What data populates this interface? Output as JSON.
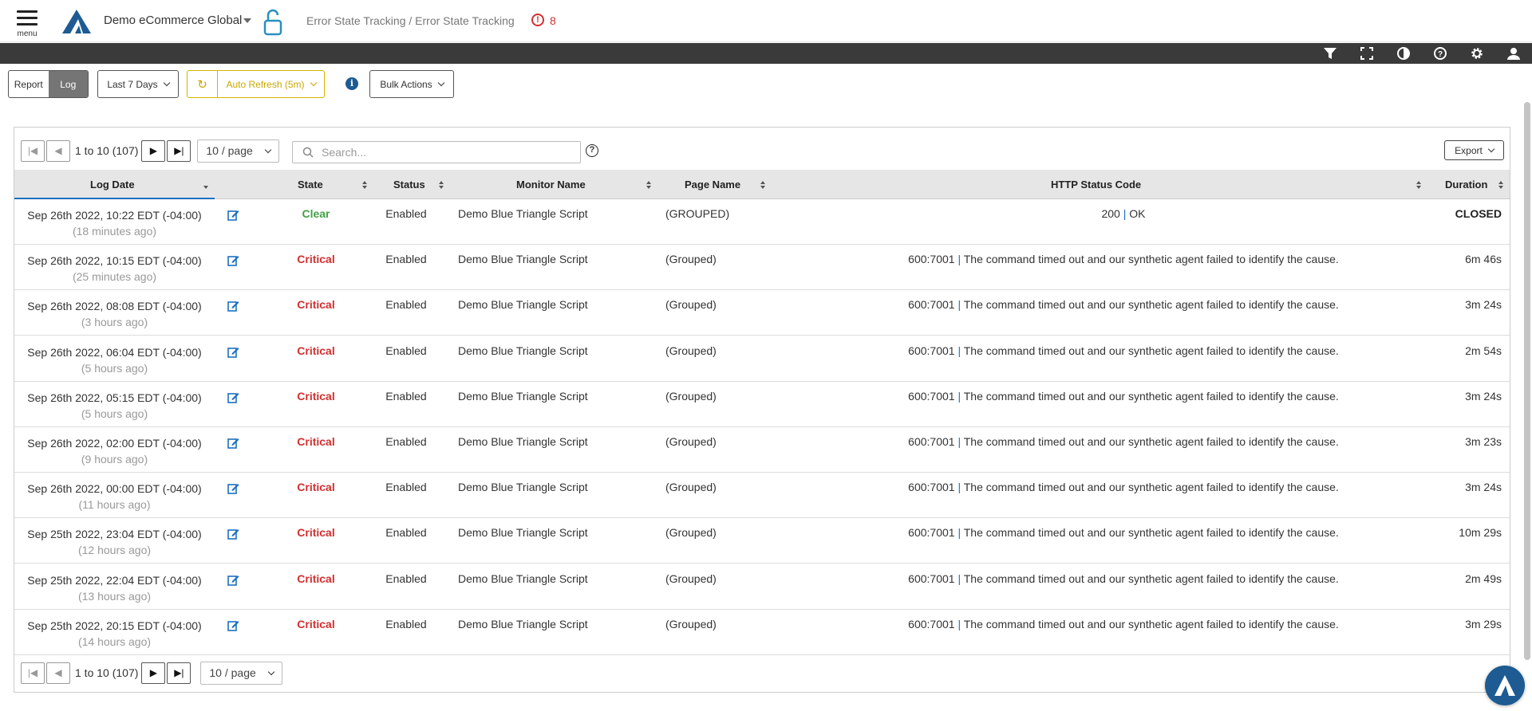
{
  "header": {
    "menu_label": "menu",
    "org_name": "Demo eCommerce Global",
    "breadcrumb": "Error State Tracking / Error State Tracking",
    "alert_count": "8"
  },
  "toolbar_icons": [
    "filter-icon",
    "fullscreen-icon",
    "contrast-icon",
    "help-icon",
    "gear-icon",
    "user-icon"
  ],
  "toolbar": {
    "report_label": "Report",
    "log_label": "Log",
    "date_range": "Last 7 Days",
    "auto_refresh": "Auto Refresh (5m)",
    "bulk_actions": "Bulk Actions"
  },
  "pager": {
    "range_text": "1 to 10 (107)",
    "page_size": "10 / page",
    "first": "|◀",
    "prev": "◀",
    "next": "▶",
    "last": "▶|"
  },
  "search": {
    "placeholder": "Search..."
  },
  "export_label": "Export",
  "columns": {
    "log_date": "Log Date",
    "state": "State",
    "status": "Status",
    "monitor_name": "Monitor Name",
    "page_name": "Page Name",
    "http_status": "HTTP Status Code",
    "duration": "Duration"
  },
  "colors": {
    "critical": "#d32f2f",
    "clear": "#43a047",
    "accent": "#1e6fbf"
  },
  "rows": [
    {
      "date": "Sep 26th 2022, 10:22 EDT (-04:00)",
      "ago": "(18 minutes ago)",
      "state": "Clear",
      "status": "Enabled",
      "monitor": "Demo Blue Triangle Script",
      "page": "(GROUPED)",
      "http_code": "200",
      "http_text": "OK",
      "duration": "CLOSED"
    },
    {
      "date": "Sep 26th 2022, 10:15 EDT (-04:00)",
      "ago": "(25 minutes ago)",
      "state": "Critical",
      "status": "Enabled",
      "monitor": "Demo Blue Triangle Script",
      "page": "(Grouped)",
      "http_code": "600:7001",
      "http_text": "The command timed out and our synthetic agent failed to identify the cause.",
      "duration": "6m 46s"
    },
    {
      "date": "Sep 26th 2022, 08:08 EDT (-04:00)",
      "ago": "(3 hours ago)",
      "state": "Critical",
      "status": "Enabled",
      "monitor": "Demo Blue Triangle Script",
      "page": "(Grouped)",
      "http_code": "600:7001",
      "http_text": "The command timed out and our synthetic agent failed to identify the cause.",
      "duration": "3m 24s"
    },
    {
      "date": "Sep 26th 2022, 06:04 EDT (-04:00)",
      "ago": "(5 hours ago)",
      "state": "Critical",
      "status": "Enabled",
      "monitor": "Demo Blue Triangle Script",
      "page": "(Grouped)",
      "http_code": "600:7001",
      "http_text": "The command timed out and our synthetic agent failed to identify the cause.",
      "duration": "2m 54s"
    },
    {
      "date": "Sep 26th 2022, 05:15 EDT (-04:00)",
      "ago": "(5 hours ago)",
      "state": "Critical",
      "status": "Enabled",
      "monitor": "Demo Blue Triangle Script",
      "page": "(Grouped)",
      "http_code": "600:7001",
      "http_text": "The command timed out and our synthetic agent failed to identify the cause.",
      "duration": "3m 24s"
    },
    {
      "date": "Sep 26th 2022, 02:00 EDT (-04:00)",
      "ago": "(9 hours ago)",
      "state": "Critical",
      "status": "Enabled",
      "monitor": "Demo Blue Triangle Script",
      "page": "(Grouped)",
      "http_code": "600:7001",
      "http_text": "The command timed out and our synthetic agent failed to identify the cause.",
      "duration": "3m 23s"
    },
    {
      "date": "Sep 26th 2022, 00:00 EDT (-04:00)",
      "ago": "(11 hours ago)",
      "state": "Critical",
      "status": "Enabled",
      "monitor": "Demo Blue Triangle Script",
      "page": "(Grouped)",
      "http_code": "600:7001",
      "http_text": "The command timed out and our synthetic agent failed to identify the cause.",
      "duration": "3m 24s"
    },
    {
      "date": "Sep 25th 2022, 23:04 EDT (-04:00)",
      "ago": "(12 hours ago)",
      "state": "Critical",
      "status": "Enabled",
      "monitor": "Demo Blue Triangle Script",
      "page": "(Grouped)",
      "http_code": "600:7001",
      "http_text": "The command timed out and our synthetic agent failed to identify the cause.",
      "duration": "10m 29s"
    },
    {
      "date": "Sep 25th 2022, 22:04 EDT (-04:00)",
      "ago": "(13 hours ago)",
      "state": "Critical",
      "status": "Enabled",
      "monitor": "Demo Blue Triangle Script",
      "page": "(Grouped)",
      "http_code": "600:7001",
      "http_text": "The command timed out and our synthetic agent failed to identify the cause.",
      "duration": "2m 49s"
    },
    {
      "date": "Sep 25th 2022, 20:15 EDT (-04:00)",
      "ago": "(14 hours ago)",
      "state": "Critical",
      "status": "Enabled",
      "monitor": "Demo Blue Triangle Script",
      "page": "(Grouped)",
      "http_code": "600:7001",
      "http_text": "The command timed out and our synthetic agent failed to identify the cause.",
      "duration": "3m 29s"
    }
  ]
}
